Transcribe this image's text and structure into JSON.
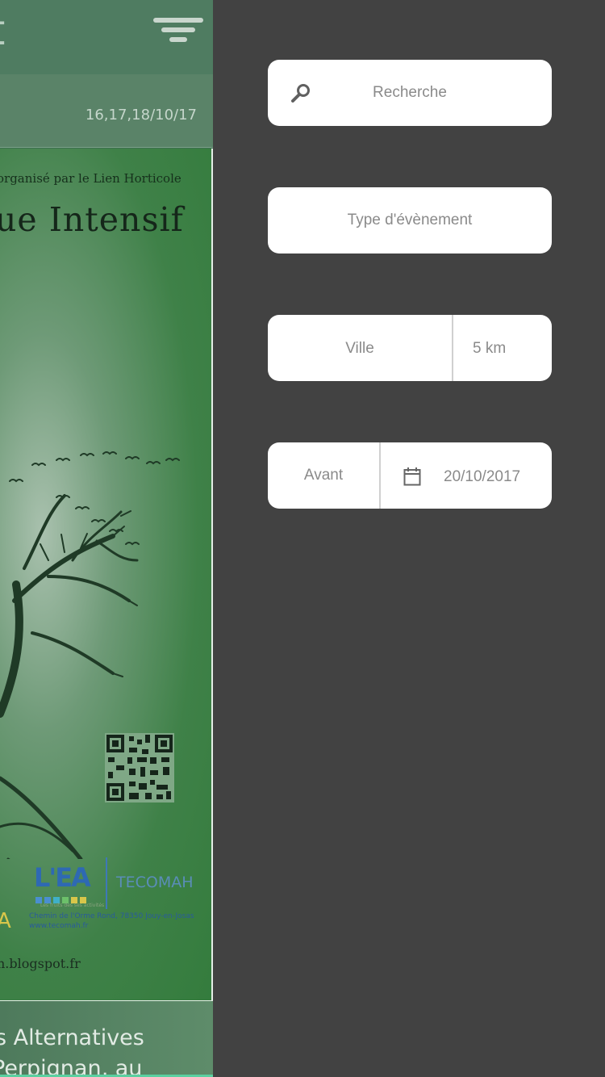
{
  "background_page": {
    "title_fragment": "t",
    "event_dates": "16,17,18/10/17",
    "poster": {
      "organizer_line": "organisé par le Lien Horticole",
      "title_fragment": "ue Intensif",
      "logo_lea": "L'EA",
      "logo_lea_sub": "Les fruits des ses activités",
      "logo_tecomah": "TECOMAH",
      "address_line1": "Chemin de l'Orme Rond, 78350 Jouy-en-Josas",
      "address_line2": "www.tecomah.fr",
      "yellow_letter": "A",
      "blog_url": "h.blogspot.fr"
    },
    "next_card": {
      "line1": "s Alternatives",
      "line2": "Perpignan, au"
    }
  },
  "filters": {
    "search": {
      "placeholder": "Recherche",
      "icon": "search-icon"
    },
    "event_type": {
      "placeholder": "Type d'évènement"
    },
    "city": {
      "placeholder": "Ville",
      "radius": "5 km"
    },
    "date": {
      "mode": "Avant",
      "value": "20/10/2017",
      "icon": "calendar-icon"
    }
  },
  "colors": {
    "drawer_bg": "#424242",
    "field_bg": "#ffffff",
    "placeholder_text": "#8a8a8a",
    "topbar_green": "#4f7c61"
  }
}
